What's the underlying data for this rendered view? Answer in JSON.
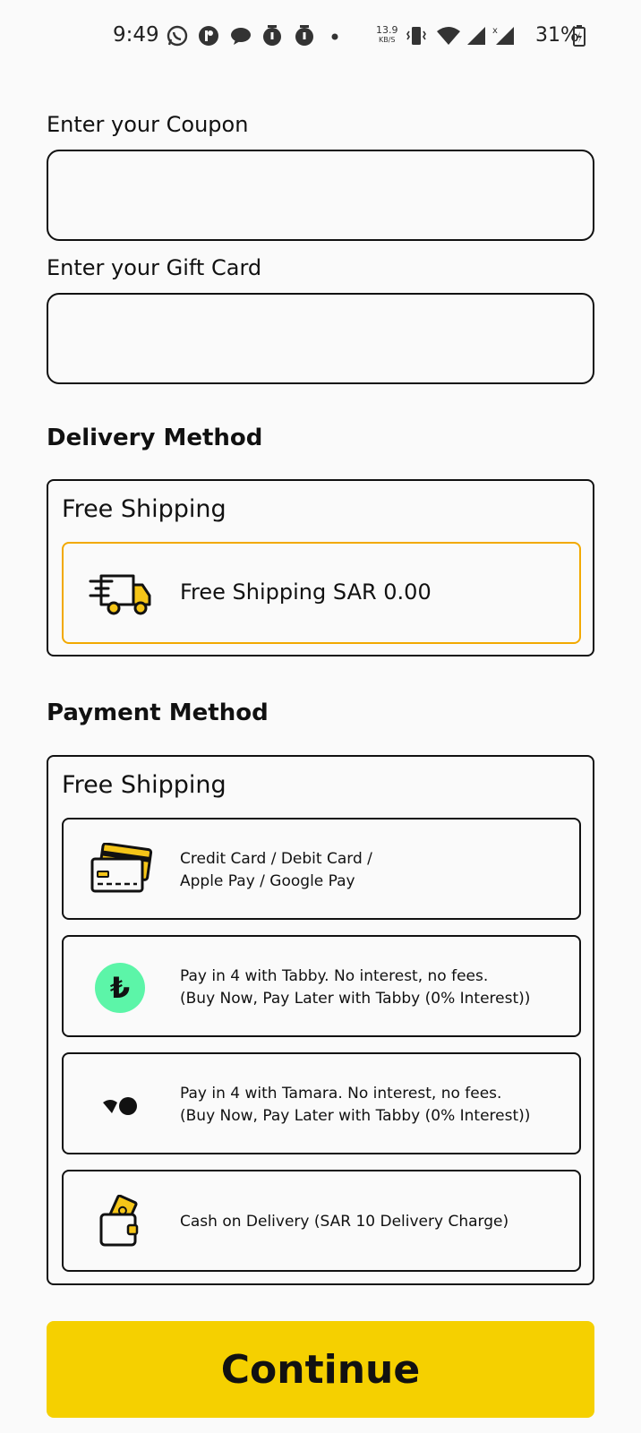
{
  "status_bar": {
    "time": "9:49",
    "net_speed_value": "13.9",
    "net_speed_unit": "KB/S",
    "battery": "31%"
  },
  "coupon": {
    "label": "Enter your Coupon",
    "value": "",
    "placeholder": ""
  },
  "gift_card": {
    "label": "Enter your Gift Card",
    "value": "",
    "placeholder": ""
  },
  "delivery": {
    "title": "Delivery Method",
    "group_title": "Free Shipping",
    "options": [
      {
        "label": "Free Shipping SAR 0.00",
        "icon": "delivery-truck-icon",
        "selected": true
      }
    ]
  },
  "payment": {
    "title": "Payment Method",
    "group_title": "Free Shipping",
    "options": [
      {
        "line1": "Credit Card / Debit Card /",
        "line2": "Apple Pay / Google Pay",
        "icon": "credit-card-icon"
      },
      {
        "line1": "Pay in 4 with Tabby. No interest, no fees.",
        "line2": "(Buy Now, Pay Later with Tabby (0% Interest))",
        "icon": "tabby-logo-icon"
      },
      {
        "line1": "Pay in 4 with Tamara. No interest, no fees.",
        "line2": "(Buy Now, Pay Later with Tabby (0% Interest))",
        "icon": "tamara-logo-icon"
      },
      {
        "line1": "Cash on Delivery (SAR 10 Delivery Charge)",
        "line2": "",
        "icon": "cash-wallet-icon"
      }
    ]
  },
  "continue_label": "Continue",
  "colors": {
    "accent": "#f5d000",
    "selected_border": "#f2a900",
    "tabby_green": "#5cf5a8",
    "icon_yellow": "#f5c518"
  }
}
